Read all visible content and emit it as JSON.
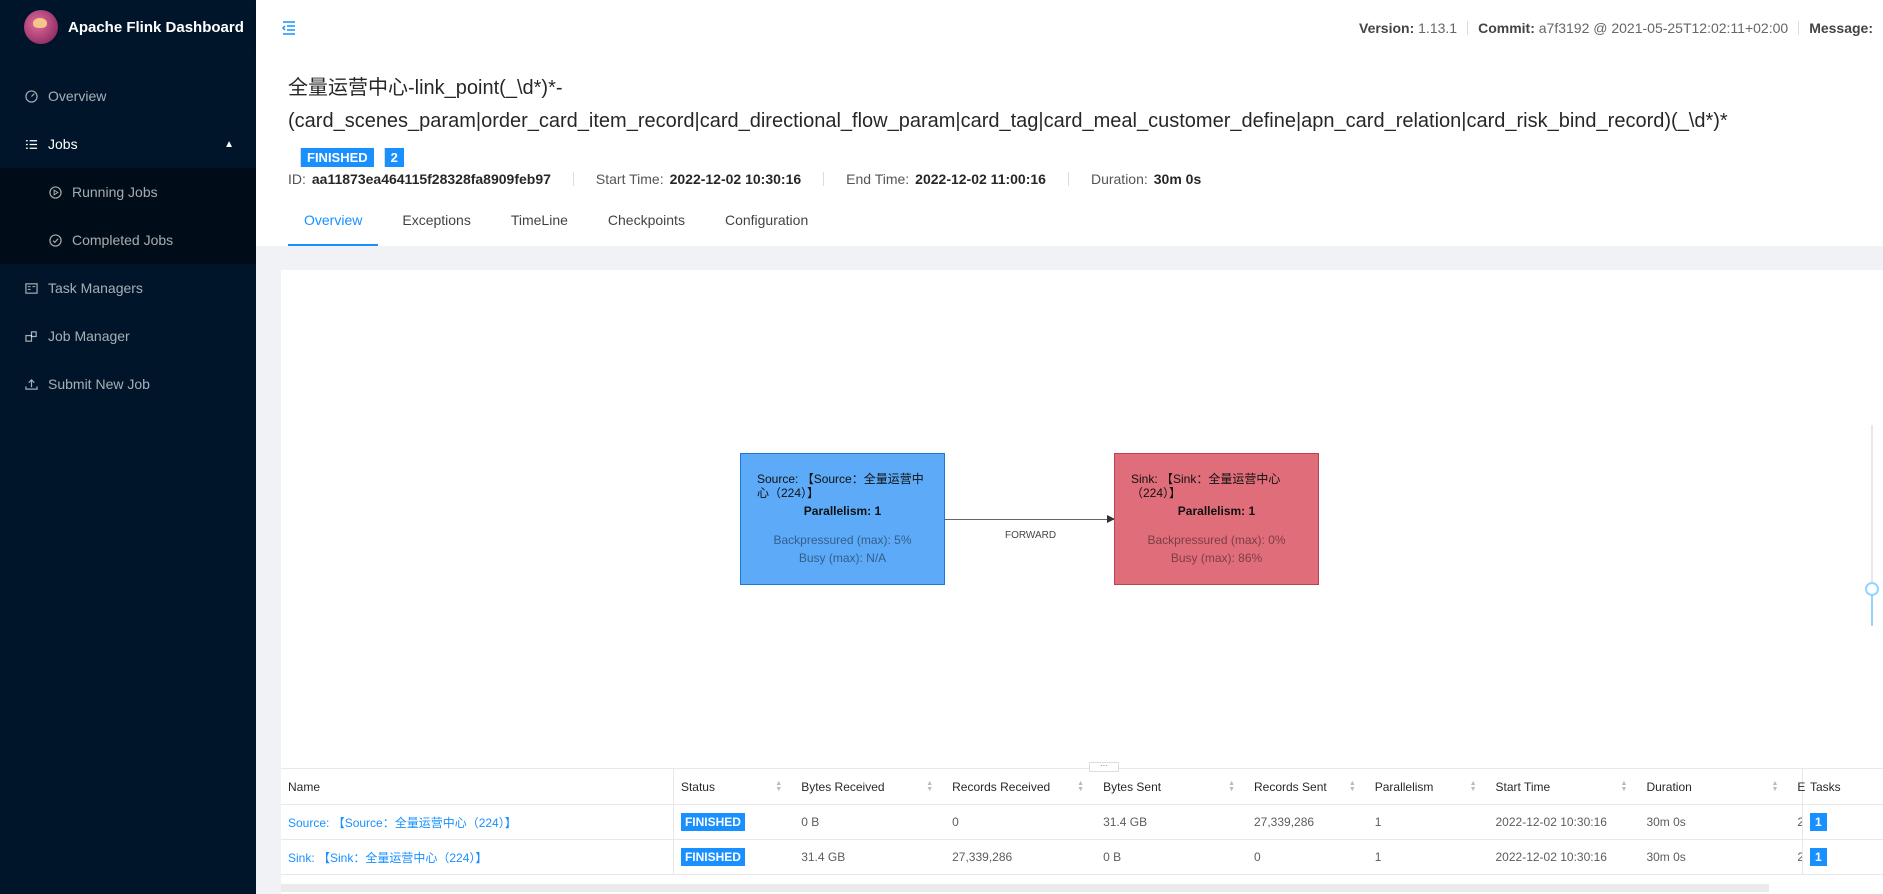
{
  "app": {
    "title": "Apache Flink Dashboard"
  },
  "sidebar": {
    "items": [
      {
        "label": "Overview",
        "icon": "dashboard-icon"
      },
      {
        "label": "Jobs",
        "icon": "unordered-list-icon"
      },
      {
        "label": "Running Jobs",
        "icon": "play-circle-icon"
      },
      {
        "label": "Completed Jobs",
        "icon": "check-circle-icon"
      },
      {
        "label": "Task Managers",
        "icon": "schedule-icon"
      },
      {
        "label": "Job Manager",
        "icon": "build-icon"
      },
      {
        "label": "Submit New Job",
        "icon": "upload-icon"
      }
    ]
  },
  "header": {
    "version_label": "Version:",
    "version": "1.13.1",
    "commit_label": "Commit:",
    "commit": "a7f3192 @ 2021-05-25T12:02:11+02:00",
    "message_label": "Message:"
  },
  "job": {
    "title": "全量运营中心-link_point(_\\d*)*-(card_scenes_param|order_card_item_record|card_directional_flow_param|card_tag|card_meal_customer_define|apn_card_relation|card_risk_bind_record)(_\\d*)*",
    "status": "FINISHED",
    "task_count": "2",
    "id_label": "ID:",
    "id": "aa11873ea464115f28328fa8909feb97",
    "start_label": "Start Time:",
    "start": "2022-12-02 10:30:16",
    "end_label": "End Time:",
    "end": "2022-12-02 11:00:16",
    "duration_label": "Duration:",
    "duration": "30m 0s"
  },
  "tabs": [
    "Overview",
    "Exceptions",
    "TimeLine",
    "Checkpoints",
    "Configuration"
  ],
  "graph": {
    "source": {
      "name": "Source: 【Source：全量运营中心（224）】",
      "parallelism": "Parallelism: 1",
      "backpressured": "Backpressured (max): 5%",
      "busy": "Busy (max): N/A",
      "color": "#5caaf8"
    },
    "sink": {
      "name": "Sink: 【Sink：全量运营中心（224）】",
      "parallelism": "Parallelism: 1",
      "backpressured": "Backpressured (max): 0%",
      "busy": "Busy (max): 86%",
      "color": "#e06e7a"
    },
    "edge_label": "FORWARD"
  },
  "table": {
    "headers": [
      "Name",
      "Status",
      "Bytes Received",
      "Records Received",
      "Bytes Sent",
      "Records Sent",
      "Parallelism",
      "Start Time",
      "Duration",
      "E",
      "Tasks"
    ],
    "rows": [
      [
        "Source: 【Source：全量运营中心（224）】",
        "FINISHED",
        "0 B",
        "0",
        "31.4 GB",
        "27,339,286",
        "1",
        "2022-12-02 10:30:16",
        "30m 0s",
        "2",
        "1"
      ],
      [
        "Sink: 【Sink：全量运营中心（224）】",
        "FINISHED",
        "31.4 GB",
        "27,339,286",
        "0 B",
        "0",
        "1",
        "2022-12-02 10:30:16",
        "30m 0s",
        "2",
        "1"
      ]
    ]
  },
  "colors": {
    "accent": "#1890ff",
    "sidebar_bg": "#001529"
  }
}
